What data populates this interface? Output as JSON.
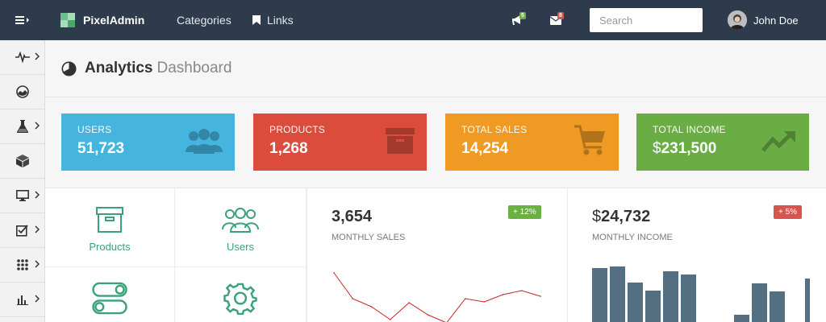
{
  "navbar": {
    "brand": "PixelAdmin",
    "links": [
      {
        "label": "Categories"
      },
      {
        "label": "Links"
      }
    ],
    "notifications_count": "5",
    "messages_count": "8",
    "search_placeholder": "Search",
    "user_name": "John Doe"
  },
  "sidebar": {
    "items": [
      {
        "icon": "pulse-icon"
      },
      {
        "icon": "dashboard-gauge-icon"
      },
      {
        "icon": "flask-icon"
      },
      {
        "icon": "cube-icon"
      },
      {
        "icon": "monitor-icon"
      },
      {
        "icon": "checkbox-icon"
      },
      {
        "icon": "grid-icon"
      },
      {
        "icon": "bar-chart-icon"
      }
    ]
  },
  "header": {
    "title": "Analytics",
    "subtitle": "Dashboard"
  },
  "stats": [
    {
      "label": "USERS",
      "value": "51,723",
      "color": "#45b5df",
      "icon": "users-icon"
    },
    {
      "label": "PRODUCTS",
      "value": "1,268",
      "color": "#db4c3c",
      "icon": "archive-icon"
    },
    {
      "label": "TOTAL SALES",
      "value": "14,254",
      "color": "#ef9a23",
      "icon": "cart-icon"
    },
    {
      "label": "TOTAL INCOME",
      "currency": "$",
      "value": "231,500",
      "color": "#6bad45",
      "icon": "trend-up-icon"
    }
  ],
  "tiles": [
    {
      "label": "Products",
      "icon": "archive-icon"
    },
    {
      "label": "Users",
      "icon": "users-icon"
    },
    {
      "label": "",
      "icon": "toggles-icon"
    },
    {
      "label": "",
      "icon": "gear-icon"
    }
  ],
  "sales_panel": {
    "value": "3,654",
    "label": "MONTHLY SALES",
    "change": "+ 12%",
    "change_color": "#6bb142"
  },
  "income_panel": {
    "currency": "$",
    "value": "24,732",
    "label": "MONTHLY INCOME",
    "change": "+ 5%",
    "change_color": "#d9534f"
  },
  "chart_data": [
    {
      "type": "line",
      "values": [
        62,
        30,
        20,
        4,
        25,
        10,
        0,
        30,
        26,
        35,
        40,
        33
      ],
      "ylim": [
        0,
        75
      ],
      "color": "#cc2222"
    },
    {
      "type": "bar",
      "values": [
        68,
        70,
        50,
        40,
        64,
        60,
        0,
        0,
        10,
        49,
        39,
        0,
        55
      ],
      "ylim": [
        0,
        75
      ],
      "color": "#546e82"
    }
  ]
}
